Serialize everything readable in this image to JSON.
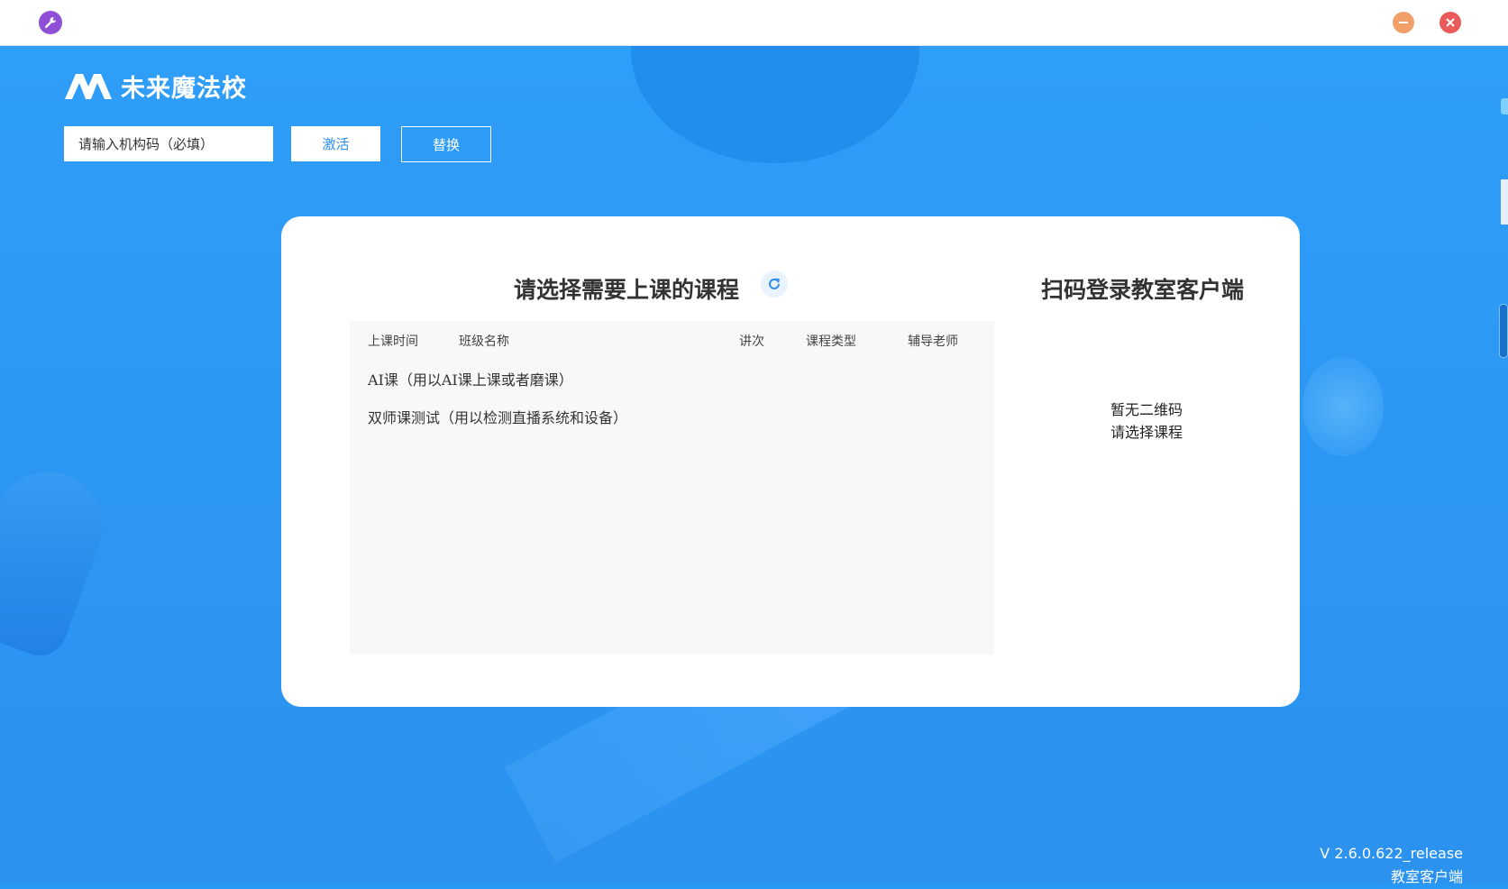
{
  "titlebar": {
    "tool_icon": "wrench-icon",
    "minimize_icon": "minus-icon",
    "close_icon": "close-icon"
  },
  "brand": {
    "name": "未来魔法校",
    "logo_icon": "double-m-logo"
  },
  "activation": {
    "input_placeholder": "请输入机构码（必填）",
    "activate_label": "激活",
    "replace_label": "替换"
  },
  "course_panel": {
    "title": "请选择需要上课的课程",
    "refresh_icon": "refresh-icon",
    "columns": [
      "上课时间",
      "班级名称",
      "讲次",
      "课程类型",
      "辅导老师"
    ],
    "rows": [
      "AI课（用以AI课上课或者磨课）",
      "双师课测试（用以检测直播系统和设备）"
    ]
  },
  "qr_panel": {
    "title": "扫码登录教室客户端",
    "empty_line1": "暂无二维码",
    "empty_line2": "请选择课程"
  },
  "footer": {
    "version": "V 2.6.0.622_release",
    "client": "教室客户端"
  },
  "colors": {
    "background": "#2a98f5",
    "accent": "#2d8ef0",
    "tool_icon": "#8e4fd6",
    "minimize": "#f2a06a",
    "close": "#ec5b5b"
  }
}
